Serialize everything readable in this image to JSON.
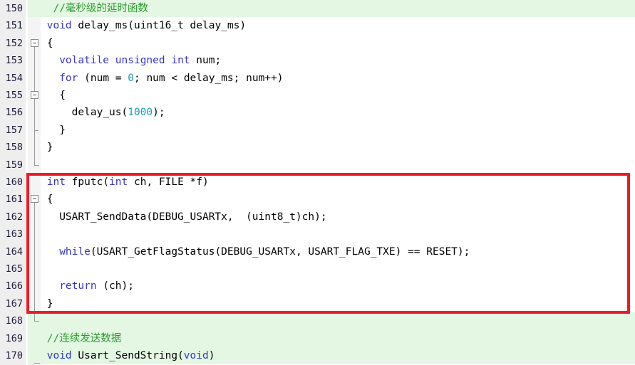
{
  "editor": {
    "title": "Source code editor",
    "language": "C",
    "first_line": 150,
    "last_line": 170,
    "colors": {
      "background": "#ffffff",
      "gutter_background": "#eeeeee",
      "fold_margin_background": "#f4f4f4",
      "line_number": "#1a1a3a",
      "keyword": "#3535c8",
      "number_literal": "#1a9bb5",
      "comment": "#2e9b2e",
      "plain_text": "#000000",
      "changed_line_bar": "#e3f7e3",
      "annotation_rect": "#ed1c24"
    },
    "annotation": {
      "name": "red-highlight-rectangle",
      "shape": "rectangle",
      "covers_lines": "160-167",
      "color": "#ed1c24",
      "border_width_px": 4
    },
    "lines": [
      {
        "number": "150",
        "changed": true,
        "fold": "none",
        "tokens": [
          {
            "t": "  ",
            "c": "plain"
          },
          {
            "t": "//毫秒级的延时函数",
            "c": "cmt"
          }
        ]
      },
      {
        "number": "151",
        "changed": false,
        "fold": "none",
        "tokens": [
          {
            "t": " ",
            "c": "plain"
          },
          {
            "t": "void",
            "c": "kw"
          },
          {
            "t": " delay_ms(",
            "c": "plain"
          },
          {
            "t": "uint16_t",
            "c": "plain"
          },
          {
            "t": " delay_ms)",
            "c": "plain"
          }
        ]
      },
      {
        "number": "152",
        "changed": false,
        "fold": "open",
        "tokens": [
          {
            "t": " {",
            "c": "plain"
          }
        ]
      },
      {
        "number": "153",
        "changed": false,
        "fold": "bar",
        "tokens": [
          {
            "t": "   ",
            "c": "plain"
          },
          {
            "t": "volatile unsigned int",
            "c": "kw"
          },
          {
            "t": " num;",
            "c": "plain"
          }
        ]
      },
      {
        "number": "154",
        "changed": false,
        "fold": "bar",
        "tokens": [
          {
            "t": "   ",
            "c": "plain"
          },
          {
            "t": "for",
            "c": "kw"
          },
          {
            "t": " (num = ",
            "c": "plain"
          },
          {
            "t": "0",
            "c": "num"
          },
          {
            "t": "; num < delay_ms; num++)",
            "c": "plain"
          }
        ]
      },
      {
        "number": "155",
        "changed": false,
        "fold": "open2",
        "tokens": [
          {
            "t": "   {",
            "c": "plain"
          }
        ]
      },
      {
        "number": "156",
        "changed": false,
        "fold": "bar2",
        "tokens": [
          {
            "t": "     delay_us(",
            "c": "plain"
          },
          {
            "t": "1000",
            "c": "num"
          },
          {
            "t": ");",
            "c": "plain"
          }
        ]
      },
      {
        "number": "157",
        "changed": false,
        "fold": "end2",
        "tokens": [
          {
            "t": "   }",
            "c": "plain"
          }
        ]
      },
      {
        "number": "158",
        "changed": false,
        "fold": "bar",
        "tokens": [
          {
            "t": " }",
            "c": "plain"
          }
        ]
      },
      {
        "number": "159",
        "changed": false,
        "fold": "end",
        "tokens": []
      },
      {
        "number": "160",
        "changed": false,
        "fold": "none",
        "tokens": [
          {
            "t": " ",
            "c": "plain"
          },
          {
            "t": "int",
            "c": "kw"
          },
          {
            "t": " fputc(",
            "c": "plain"
          },
          {
            "t": "int",
            "c": "kw"
          },
          {
            "t": " ch, FILE *f)",
            "c": "plain"
          }
        ]
      },
      {
        "number": "161",
        "changed": false,
        "fold": "open",
        "tokens": [
          {
            "t": " {",
            "c": "plain"
          }
        ]
      },
      {
        "number": "162",
        "changed": false,
        "fold": "bar",
        "tokens": [
          {
            "t": "   USART_SendData(DEBUG_USARTx,  (uint8_t)ch);",
            "c": "plain"
          }
        ]
      },
      {
        "number": "163",
        "changed": false,
        "fold": "bar",
        "tokens": []
      },
      {
        "number": "164",
        "changed": false,
        "fold": "bar",
        "tokens": [
          {
            "t": "   ",
            "c": "plain"
          },
          {
            "t": "while",
            "c": "kw"
          },
          {
            "t": "(USART_GetFlagStatus(DEBUG_USARTx, USART_FLAG_TXE) == RESET);",
            "c": "plain"
          }
        ]
      },
      {
        "number": "165",
        "changed": false,
        "fold": "bar",
        "tokens": []
      },
      {
        "number": "166",
        "changed": false,
        "fold": "bar",
        "tokens": [
          {
            "t": "   ",
            "c": "plain"
          },
          {
            "t": "return",
            "c": "kw"
          },
          {
            "t": " (ch);",
            "c": "plain"
          }
        ]
      },
      {
        "number": "167",
        "changed": false,
        "fold": "bar",
        "tokens": [
          {
            "t": " }",
            "c": "plain"
          }
        ]
      },
      {
        "number": "168",
        "changed": true,
        "fold": "end",
        "tokens": []
      },
      {
        "number": "169",
        "changed": true,
        "fold": "none",
        "tokens": [
          {
            "t": " ",
            "c": "plain"
          },
          {
            "t": "//连续发送数据",
            "c": "cmt"
          }
        ]
      },
      {
        "number": "170",
        "changed": true,
        "fold": "none",
        "tokens": [
          {
            "t": " ",
            "c": "plain"
          },
          {
            "t": "void",
            "c": "kw"
          },
          {
            "t": " Usart_SendString(",
            "c": "plain"
          },
          {
            "t": "void",
            "c": "kw"
          },
          {
            "t": ")",
            "c": "plain"
          }
        ]
      }
    ]
  }
}
